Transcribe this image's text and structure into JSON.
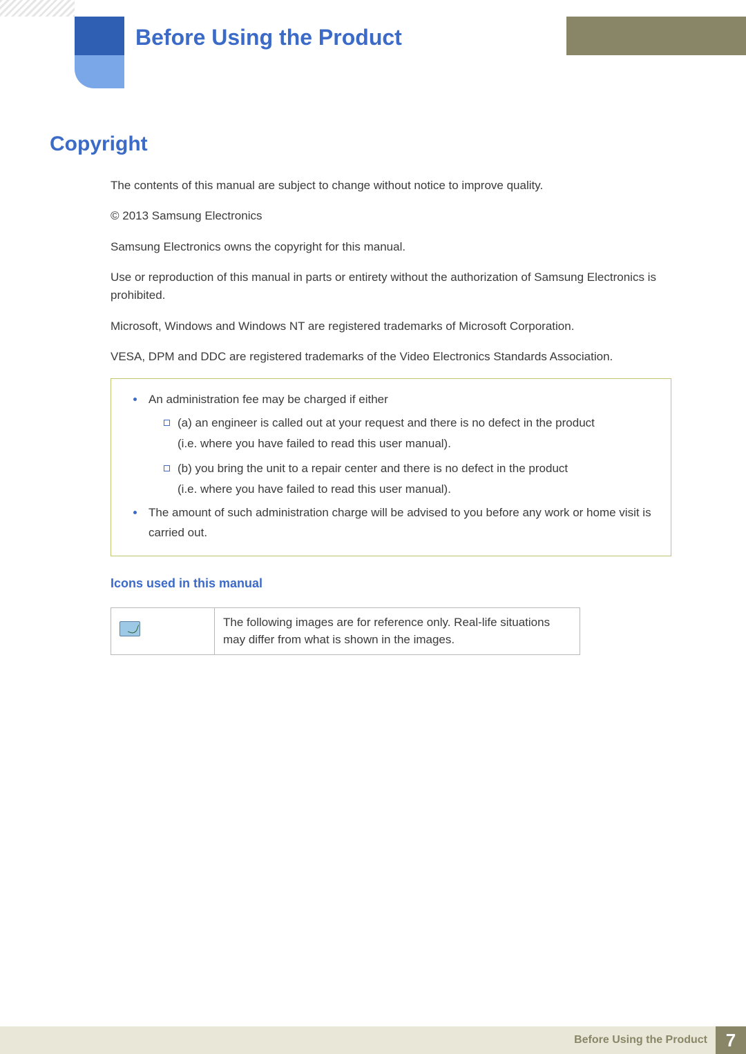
{
  "header": {
    "chapter_title": "Before Using the Product"
  },
  "section": {
    "title": "Copyright",
    "paragraphs": {
      "p1": "The contents of this manual are subject to change without notice to improve quality.",
      "p2": "© 2013 Samsung Electronics",
      "p3": "Samsung Electronics owns the copyright for this manual.",
      "p4": "Use or reproduction of this manual in parts or entirety without the authorization of Samsung Electronics is prohibited.",
      "p5": "Microsoft, Windows and Windows NT are registered trademarks of Microsoft Corporation.",
      "p6": "VESA, DPM and DDC are registered trademarks of the Video Electronics Standards Association."
    }
  },
  "note_box": {
    "item1": "An administration fee may be charged if either",
    "item1_a_line1": "(a) an engineer is called out at your request and there is no defect in the product",
    "item1_a_line2": "(i.e. where you have failed to read this user manual).",
    "item1_b_line1": "(b) you bring the unit to a repair center and there is no defect in the product",
    "item1_b_line2": "(i.e. where you have failed to read this user manual).",
    "item2": "The amount of such administration charge will be advised to you before any work or home visit is carried out."
  },
  "icons_section": {
    "heading": "Icons used in this manual",
    "row1_desc": "The following images are for reference only. Real-life situations may differ from what is shown in the images."
  },
  "footer": {
    "label": "Before Using the Product",
    "page": "7"
  }
}
